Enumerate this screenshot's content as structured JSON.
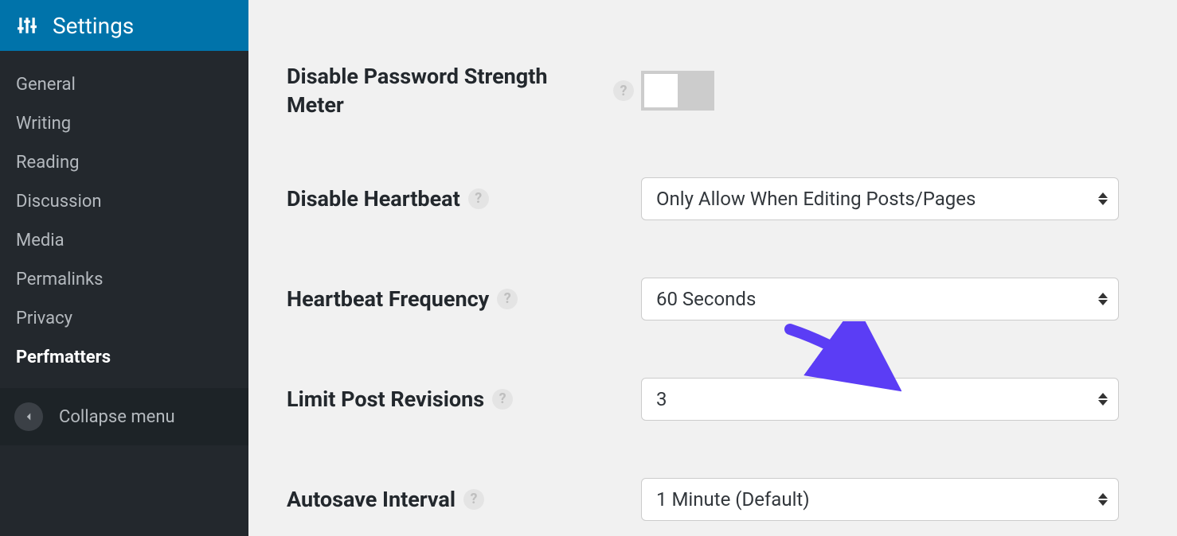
{
  "sidebar": {
    "current": "Settings",
    "items": [
      {
        "label": "General",
        "active": false
      },
      {
        "label": "Writing",
        "active": false
      },
      {
        "label": "Reading",
        "active": false
      },
      {
        "label": "Discussion",
        "active": false
      },
      {
        "label": "Media",
        "active": false
      },
      {
        "label": "Permalinks",
        "active": false
      },
      {
        "label": "Privacy",
        "active": false
      },
      {
        "label": "Perfmatters",
        "active": true
      }
    ],
    "collapse_label": "Collapse menu"
  },
  "settings": {
    "disable_password_strength_meter": {
      "label": "Disable Password Strength Meter",
      "value": false
    },
    "disable_heartbeat": {
      "label": "Disable Heartbeat",
      "value": "Only Allow When Editing Posts/Pages"
    },
    "heartbeat_frequency": {
      "label": "Heartbeat Frequency",
      "value": "60 Seconds"
    },
    "limit_post_revisions": {
      "label": "Limit Post Revisions",
      "value": "3"
    },
    "autosave_interval": {
      "label": "Autosave Interval",
      "value": "1 Minute (Default)"
    }
  },
  "help_glyph": "?",
  "annotation": {
    "target": "limit_post_revisions",
    "color": "#5b3df5"
  }
}
